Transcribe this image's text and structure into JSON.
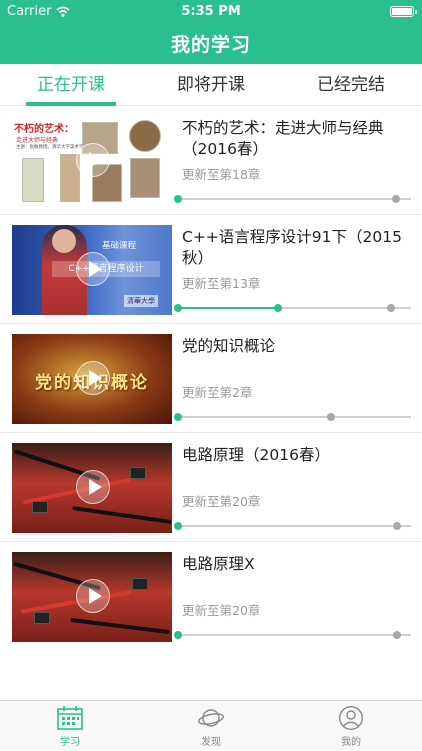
{
  "status_bar": {
    "carrier": "Carrier",
    "time": "5:35 PM"
  },
  "nav": {
    "title": "我的学习"
  },
  "tabs": [
    {
      "label": "正在开课",
      "active": true
    },
    {
      "label": "即将开课",
      "active": false
    },
    {
      "label": "已经完结",
      "active": false
    }
  ],
  "courses": [
    {
      "title": "不朽的艺术：走进大师与经典（2016春）",
      "update": "更新至第18章",
      "progress": 0,
      "thumb_text": [
        "不朽的艺术：",
        "走进大师与经典",
        "主讲：张敢教授、清华大学美术学院"
      ]
    },
    {
      "title": "C++语言程序设计91下（2015秋）",
      "update": "更新至第13章",
      "progress": 0.43,
      "thumb_text": [
        "基础课程",
        "C++语言程序设计",
        "清華大學"
      ]
    },
    {
      "title": "党的知识概论",
      "update": "更新至第2章",
      "progress": 0,
      "thumb_text": [
        "党的知识概论"
      ]
    },
    {
      "title": "电路原理（2016春）",
      "update": "更新至第20章",
      "progress": 0
    },
    {
      "title": "电路原理X",
      "update": "更新至第20章",
      "progress": 0
    }
  ],
  "bottom_tabs": [
    {
      "label": "学习",
      "icon": "calendar-icon",
      "active": true
    },
    {
      "label": "发现",
      "icon": "planet-icon",
      "active": false
    },
    {
      "label": "我的",
      "icon": "user-icon",
      "active": false
    }
  ],
  "colors": {
    "accent": "#2bbf8f",
    "muted": "#999999",
    "track": "#cfcfcf"
  }
}
